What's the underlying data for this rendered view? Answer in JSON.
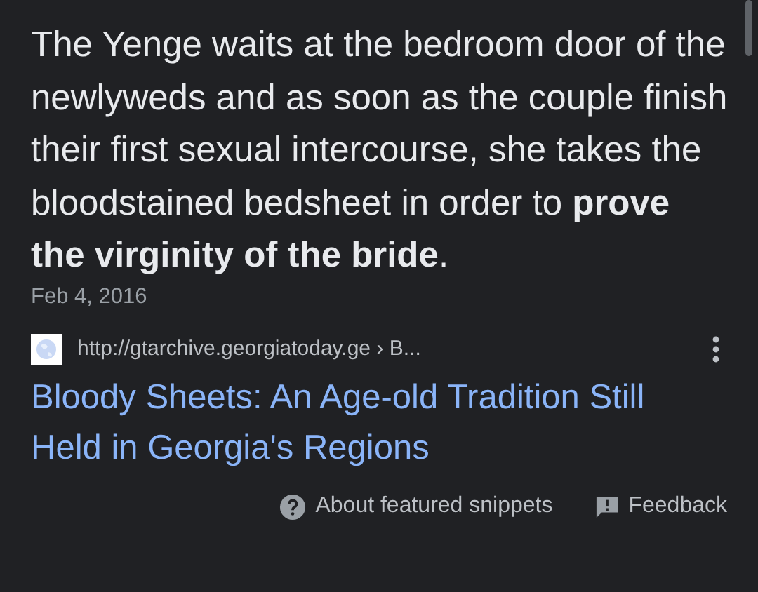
{
  "snippet": {
    "text": "The Yenge waits at the bedroom door of the newlyweds and as soon as the couple finish their first sexual intercourse, she takes the bloodstained bedsheet in order to **prove the virginity of the bride**.",
    "date": "Feb 4, 2016"
  },
  "result": {
    "url": "http://gtarchive.georgiatoday.ge › B...",
    "title": "Bloody Sheets: An Age-old Tradition Still Held in Georgia's Regions"
  },
  "footer": [
    {
      "kind": "help",
      "label": "About featured snippets"
    },
    {
      "kind": "feedback",
      "label": "Feedback"
    }
  ]
}
